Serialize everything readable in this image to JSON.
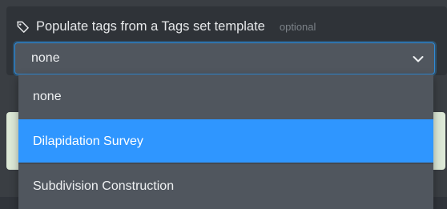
{
  "field": {
    "label": "Populate tags from a Tags set template",
    "optional": "optional",
    "icon": "tag-icon"
  },
  "select": {
    "value": "none",
    "icon": "chevron-down-icon"
  },
  "dropdown": {
    "options": [
      {
        "label": "none"
      },
      {
        "label": "Dilapidation Survey",
        "highlighted": true
      },
      {
        "label": "Subdivision Construction"
      }
    ]
  },
  "colors": {
    "background": "#3a3e43",
    "panel": "#2f3338",
    "control": "#50565e",
    "focus_border": "#2f8bd8",
    "highlight": "#2f96ff",
    "notice": "#dde9d7"
  }
}
